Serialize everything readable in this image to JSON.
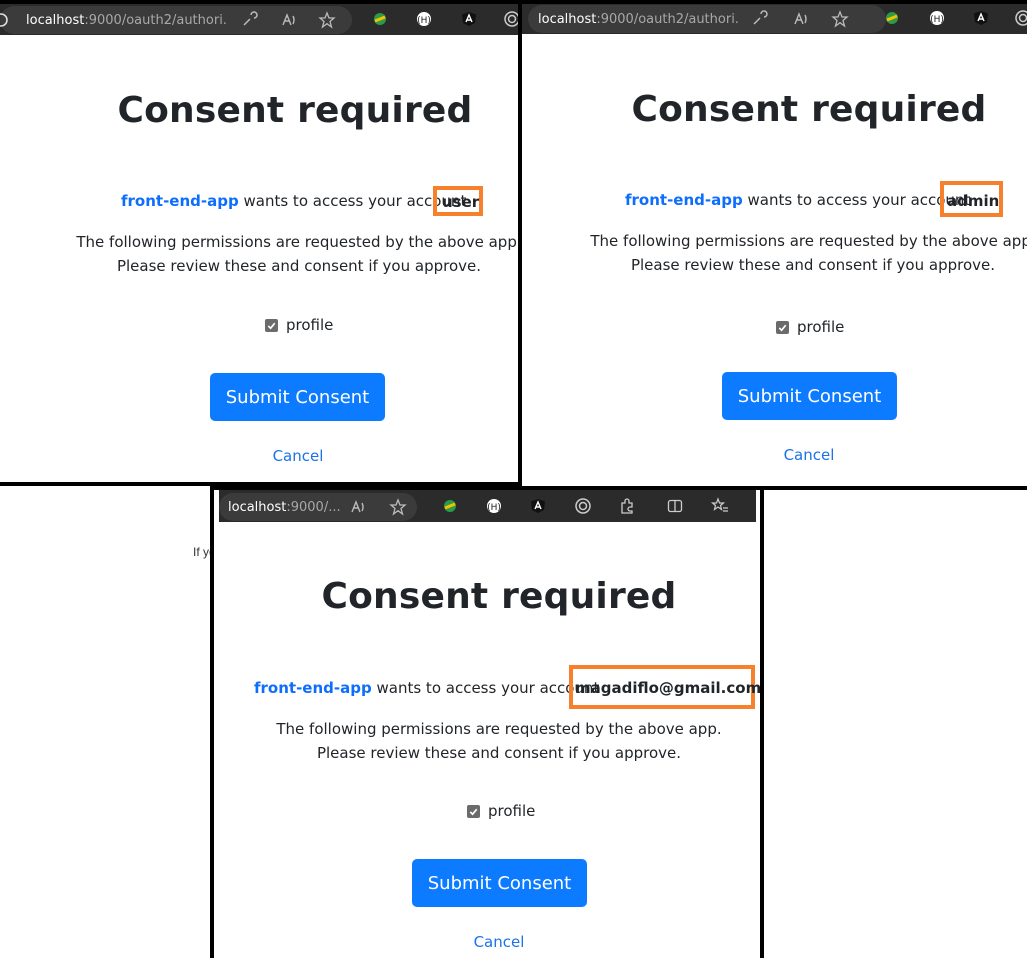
{
  "panels": [
    {
      "url_host": "localhost",
      "url_rest": ":9000/oauth2/authori...",
      "title": "Consent required",
      "client_name": "front-end-app",
      "access_text": "wants to access your account",
      "account": "user",
      "info_line1": "The following permissions are requested by the above app.",
      "info_line2": "Please review these and consent if you approve.",
      "scope": "profile",
      "scope_checked": true,
      "submit_label": "Submit Consent",
      "cancel_label": "Cancel"
    },
    {
      "url_host": "localhost",
      "url_rest": ":9000/oauth2/authori...",
      "title": "Consent required",
      "client_name": "front-end-app",
      "access_text": "wants to access your account",
      "account": "admin",
      "info_line1": "The following permissions are requested by the above app.",
      "info_line2": "Please review these and consent if you approve.",
      "scope": "profile",
      "scope_checked": true,
      "submit_label": "Submit Consent",
      "cancel_label": "Cancel"
    },
    {
      "url_host": "localhost",
      "url_rest": ":9000/...",
      "title": "Consent required",
      "client_name": "front-end-app",
      "access_text": "wants to access your account",
      "account": "magadiflo@gmail.com",
      "info_line1": "The following permissions are requested by the above app.",
      "info_line2": "Please review these and consent if you approve.",
      "scope": "profile",
      "scope_checked": true,
      "submit_label": "Submit Consent",
      "cancel_label": "Cancel"
    }
  ],
  "stray_text": "If yo",
  "icons": {
    "refresh": "refresh-icon",
    "reader": "reader-mode-icon",
    "read_aloud": "read-aloud-icon",
    "favorite": "favorite-star-icon",
    "extension_green": "extension-globe-icon",
    "extension_h": "extension-h-icon",
    "angular": "angular-icon",
    "target": "target-extension-icon",
    "puzzle": "extensions-puzzle-icon",
    "split": "split-screen-icon",
    "favorites_list": "favorites-list-icon"
  },
  "colors": {
    "accent_blue": "#0d6efd",
    "button_blue": "#0d7bff",
    "highlight_orange": "#f6802b",
    "toolbar_bg": "#2b2b2b"
  }
}
